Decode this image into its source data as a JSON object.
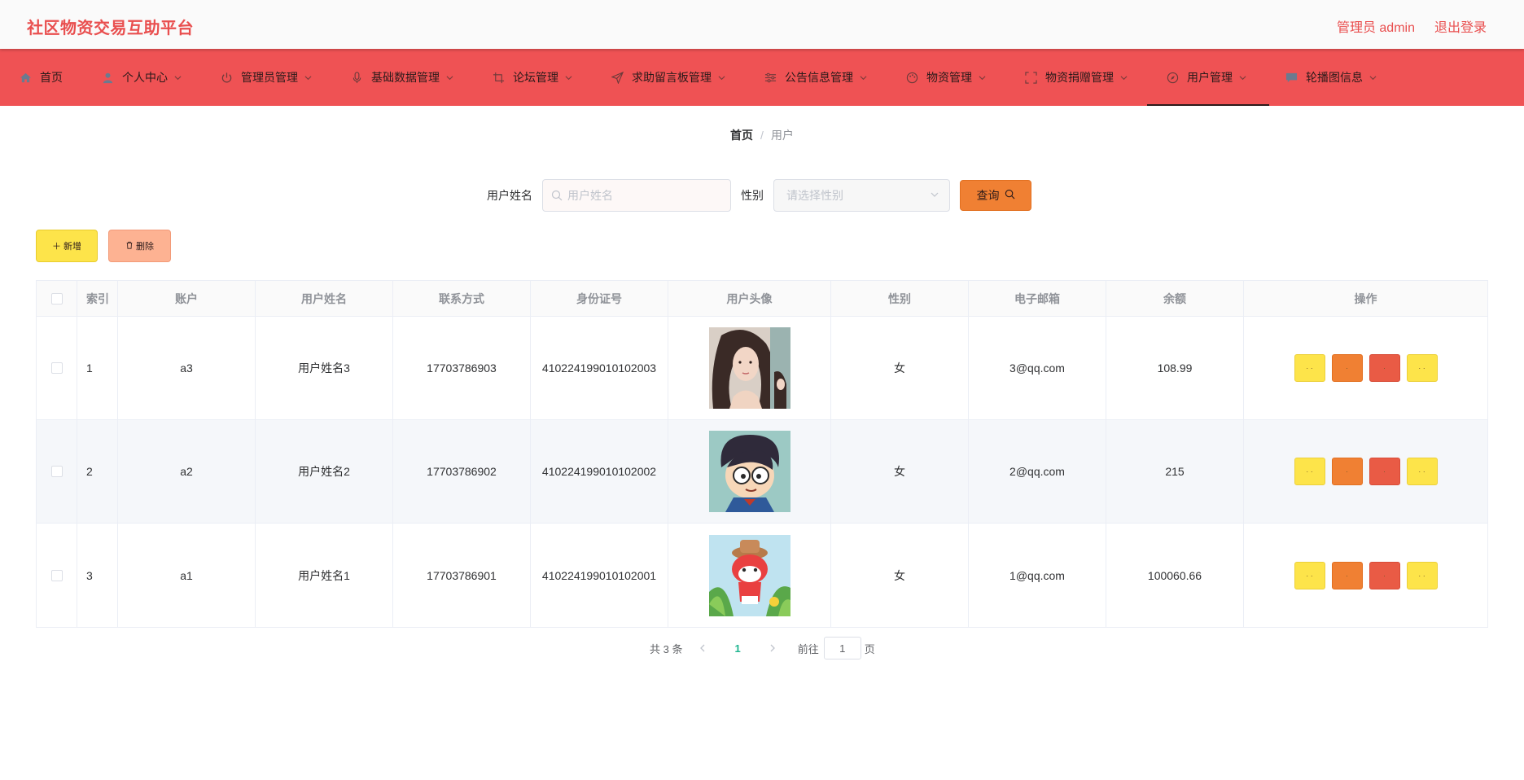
{
  "app": {
    "title": "社区物资交易互助平台",
    "user_label": "管理员 admin",
    "logout_label": "退出登录",
    "accent": "#ef5254"
  },
  "nav": {
    "items": [
      {
        "label": "首页",
        "icon": "home-icon",
        "dropdown": false
      },
      {
        "label": "个人中心",
        "icon": "user-icon",
        "dropdown": true
      },
      {
        "label": "管理员管理",
        "icon": "power-icon",
        "dropdown": true
      },
      {
        "label": "基础数据管理",
        "icon": "microphone-icon",
        "dropdown": true
      },
      {
        "label": "论坛管理",
        "icon": "crop-icon",
        "dropdown": true
      },
      {
        "label": "求助留言板管理",
        "icon": "send-icon",
        "dropdown": true
      },
      {
        "label": "公告信息管理",
        "icon": "sliders-icon",
        "dropdown": true
      },
      {
        "label": "物资管理",
        "icon": "palette-icon",
        "dropdown": true
      },
      {
        "label": "物资捐赠管理",
        "icon": "fullscreen-icon",
        "dropdown": true
      },
      {
        "label": "用户管理",
        "icon": "compass-icon",
        "dropdown": true,
        "active": true
      },
      {
        "label": "轮播图信息",
        "icon": "chat-icon",
        "dropdown": true
      }
    ]
  },
  "breadcrumb": {
    "home": "首页",
    "separator": "/",
    "current": "用户"
  },
  "search": {
    "name_label": "用户姓名",
    "name_placeholder": "用户姓名",
    "gender_label": "性别",
    "gender_placeholder": "请选择性别",
    "query_label": "查询"
  },
  "toolbar": {
    "add_label": "新增",
    "delete_label": "删除"
  },
  "table": {
    "headers": {
      "index": "索引",
      "account": "账户",
      "name": "用户姓名",
      "phone": "联系方式",
      "id_number": "身份证号",
      "avatar": "用户头像",
      "gender": "性别",
      "email": "电子邮箱",
      "balance": "余额",
      "ops": "操作"
    },
    "rows": [
      {
        "index": "1",
        "account": "a3",
        "name": "用户姓名3",
        "phone": "17703786903",
        "id_number": "410224199010102003",
        "avatar": "portrait-woman",
        "gender": "女",
        "email": "3@qq.com",
        "balance": "108.99"
      },
      {
        "index": "2",
        "account": "a2",
        "name": "用户姓名2",
        "phone": "17703786902",
        "id_number": "410224199010102002",
        "avatar": "portrait-cartoon-boy",
        "gender": "女",
        "email": "2@qq.com",
        "balance": "215"
      },
      {
        "index": "3",
        "account": "a1",
        "name": "用户姓名1",
        "phone": "17703786901",
        "id_number": "410224199010102001",
        "avatar": "portrait-cartoon-fox",
        "gender": "女",
        "email": "1@qq.com",
        "balance": "100060.66"
      }
    ],
    "op_labels": [
      "· ·",
      "·",
      "·",
      "· ·"
    ]
  },
  "pager": {
    "total": "共 3 条",
    "current_page": "1",
    "goto_label": "前往",
    "goto_value": "1",
    "page_suffix": "页"
  }
}
